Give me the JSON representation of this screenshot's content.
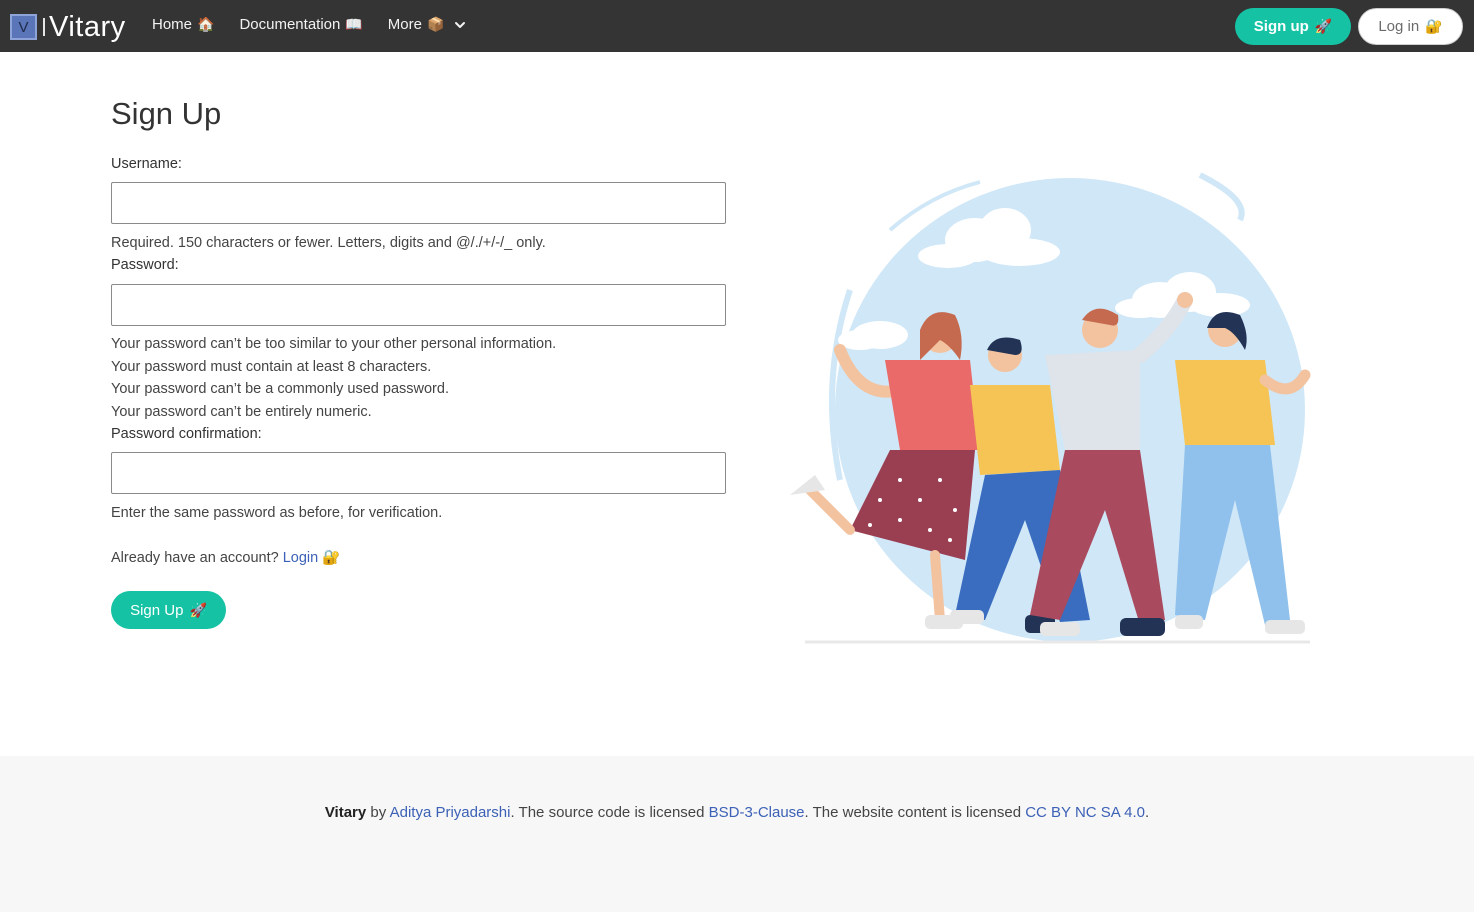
{
  "navbar": {
    "logo_letter": "V",
    "brand": "Vitary",
    "links": [
      {
        "label": "Home",
        "emoji": "🏠"
      },
      {
        "label": "Documentation",
        "emoji": "📖"
      },
      {
        "label": "More",
        "emoji": "📦"
      }
    ],
    "signup_label": "Sign up",
    "signup_emoji": "🚀",
    "login_label": "Log in",
    "login_emoji": "🔐"
  },
  "form": {
    "title": "Sign Up",
    "username_label": "Username:",
    "username_value": "",
    "username_help": "Required. 150 characters or fewer. Letters, digits and @/./+/-/_ only.",
    "password_label": "Password:",
    "password_value": "",
    "password_help": [
      "Your password can’t be too similar to your other personal information.",
      "Your password must contain at least 8 characters.",
      "Your password can’t be a commonly used password.",
      "Your password can’t be entirely numeric."
    ],
    "confirm_label": "Password confirmation:",
    "confirm_value": "",
    "confirm_help": "Enter the same password as before, for verification.",
    "already_text": "Already have an account?",
    "login_link": "Login",
    "login_emoji": "🔐",
    "submit_label": "Sign Up",
    "submit_emoji": "🚀"
  },
  "footer": {
    "brand": "Vitary",
    "by": "by",
    "author": "Aditya Priyadarshi",
    "source_text": ". The source code is licensed",
    "source_license": "BSD-3-Clause",
    "content_text": ". The website content is licensed",
    "content_license": "CC BY NC SA 4.0",
    "end": "."
  },
  "colors": {
    "accent": "#16c2a4",
    "navbar": "#343434",
    "link": "#3c61b6"
  }
}
